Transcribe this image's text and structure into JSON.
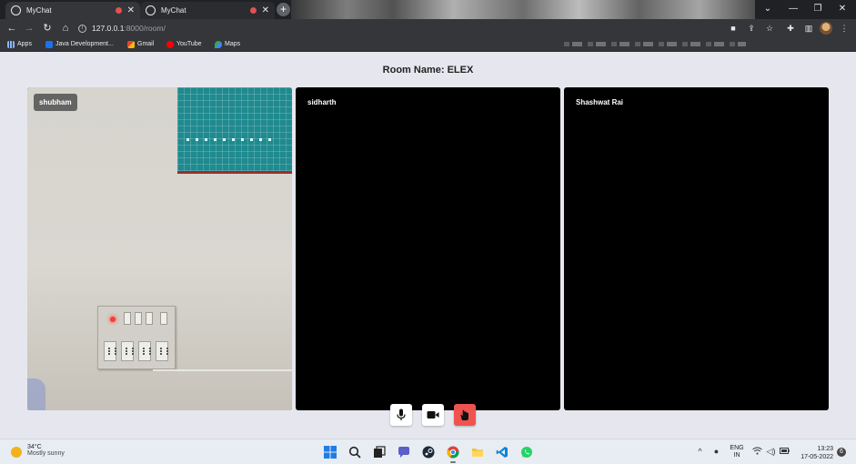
{
  "browser": {
    "tabs": [
      {
        "title": "MyChat",
        "active": true
      },
      {
        "title": "MyChat",
        "active": false
      }
    ],
    "new_tab_label": "+",
    "url_host": "127.0.0.1",
    "url_path": ":8000/room/",
    "bookmarks": [
      "Apps",
      "Java Development...",
      "Gmail",
      "YouTube",
      "Maps"
    ]
  },
  "room": {
    "title": "Room Name: ELEX",
    "participants": [
      {
        "name": "shubham",
        "camera_on": true
      },
      {
        "name": "sidharth",
        "camera_on": false
      },
      {
        "name": "Shashwat Rai",
        "camera_on": false
      }
    ]
  },
  "controls": {
    "mic_icon": "microphone-icon",
    "camera_icon": "video-camera-icon",
    "leave_icon": "hand-icon",
    "leave_color": "#ef5350"
  },
  "taskbar": {
    "weather_temp": "34°C",
    "weather_desc": "Mostly sunny",
    "lang_line1": "ENG",
    "lang_line2": "IN",
    "time": "13:23",
    "date": "17-05-2022",
    "notification_count": "6"
  }
}
